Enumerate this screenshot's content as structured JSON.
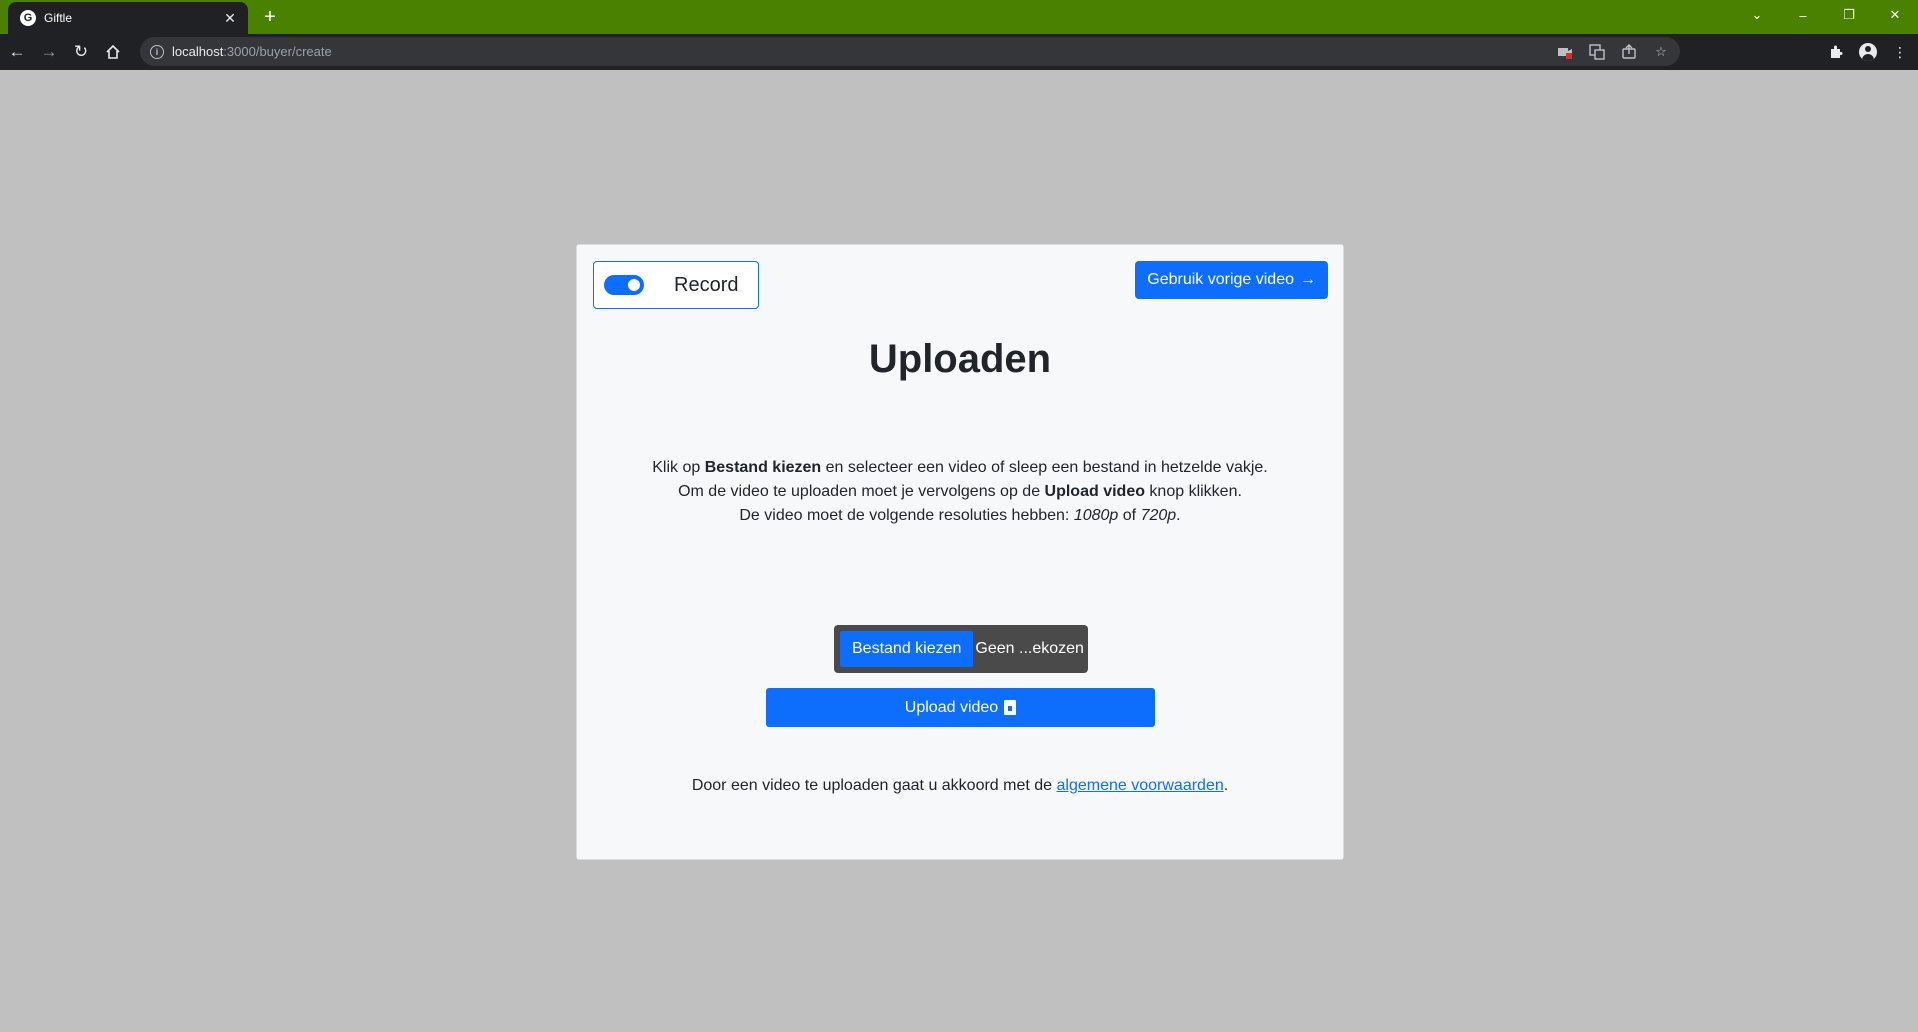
{
  "browser": {
    "tab_favicon": "G",
    "tab_title": "Giftle",
    "tab_close": "✕",
    "new_tab": "+",
    "url_host": "localhost",
    "url_path": ":3000/buyer/create",
    "window_controls": {
      "list": "⌄",
      "minimize": "–",
      "restore": "❐",
      "close": "✕"
    }
  },
  "card": {
    "record_label": "Record",
    "record_on": true,
    "previous_video_label": "Gebruik vorige video",
    "previous_video_arrow": "→",
    "title": "Uploaden",
    "instructions": {
      "line1_pre": "Klik op ",
      "line1_bold": "Bestand kiezen",
      "line1_post": " en selecteer een video of sleep een bestand in hetzelde vakje.",
      "line2_pre": "Om de video te uploaden moet je vervolgens op de ",
      "line2_bold": "Upload video",
      "line2_post": " knop klikken.",
      "line3_pre": "De video moet de volgende resoluties hebben: ",
      "line3_em1": "1080p",
      "line3_mid": " of ",
      "line3_em2": "720p",
      "line3_post": "."
    },
    "file_button_label": "Bestand kiezen",
    "file_status": "Geen ...ekozen",
    "upload_label": "Upload video",
    "terms_pre": "Door een video te uploaden gaat u akkoord met de ",
    "terms_link": "algemene voorwaarden",
    "terms_post": "."
  },
  "colors": {
    "tabstrip": "#4a8200",
    "page_background": "#c0c0c0",
    "primary": "#0d6efd",
    "file_input_bg": "#4a4a4a"
  }
}
